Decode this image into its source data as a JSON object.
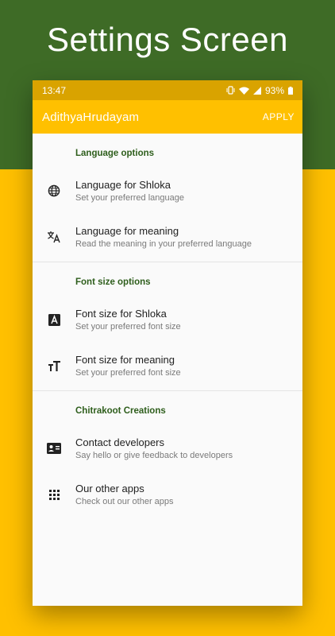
{
  "promo": {
    "title": "Settings Screen",
    "top_color": "#3E6B26",
    "bottom_color": "#FFC000"
  },
  "status_bar": {
    "time": "13:47",
    "battery": "93%"
  },
  "app_bar": {
    "title": "AdithyaHrudayam",
    "apply_label": "APPLY"
  },
  "sections": [
    {
      "header": "Language options",
      "items": [
        {
          "icon": "globe-icon",
          "title": "Language for Shloka",
          "subtitle": "Set your preferred language"
        },
        {
          "icon": "translate-icon",
          "title": "Language for meaning",
          "subtitle": "Read the meaning in your preferred language"
        }
      ]
    },
    {
      "header": "Font size options",
      "items": [
        {
          "icon": "font-box-icon",
          "title": "Font size for Shloka",
          "subtitle": "Set your preferred font size"
        },
        {
          "icon": "text-size-icon",
          "title": "Font size for meaning",
          "subtitle": "Set your preferred font size"
        }
      ]
    },
    {
      "header": "Chitrakoot Creations",
      "items": [
        {
          "icon": "contact-card-icon",
          "title": "Contact developers",
          "subtitle": "Say hello or give feedback to developers"
        },
        {
          "icon": "apps-grid-icon",
          "title": "Our other apps",
          "subtitle": "Check out our other apps"
        }
      ]
    }
  ]
}
